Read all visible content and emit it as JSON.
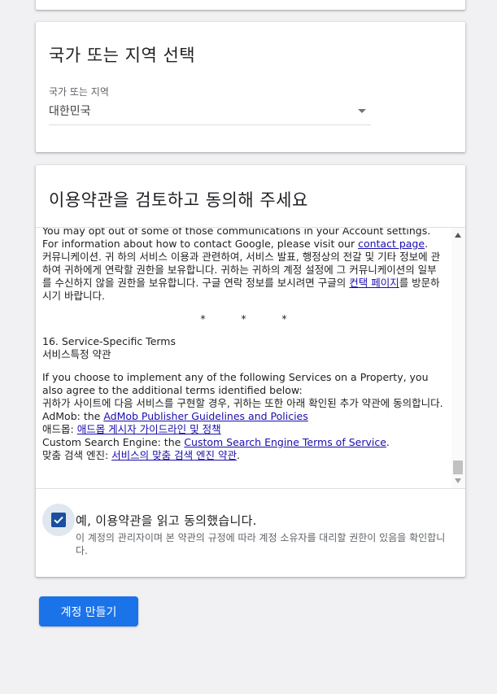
{
  "country_section": {
    "title": "국가 또는 지역 선택",
    "field_label": "국가 또는 지역",
    "selected_value": "대한민국"
  },
  "terms_section": {
    "title": "이용약관을 검토하고 동의해 주세요",
    "content": {
      "p1_en_a": "You may opt out of some of those communications in your Account settings. For information about how to contact Google, please visit our ",
      "p1_en_link": "contact page",
      "p1_en_b": ".",
      "p1_ko_a": "커뮤니케이션. 귀 하의 서비스 이용과 관련하여, 서비스 발표, 행정상의 전갈 및 기타 정보에 관하여 귀하에게 연락할 권한을 보유합니다. 귀하는 귀하의 계정 설정에 그 커뮤니케이션의 일부를 수신하지 않을 권한을 보유합니다. 구글 연락 정보를 보시려면 구글의 ",
      "p1_ko_link": "컨택 페이지",
      "p1_ko_b": "를 방문하시기 바랍니다.",
      "stars": [
        "*",
        "*",
        "*"
      ],
      "s16_en": "16. Service-Specific Terms",
      "s16_ko": "서비스특정 약관",
      "p2_en": "If you choose to implement any of the following Services on a Property, you also agree to the additional terms identified below:",
      "p2_ko": "귀하가 사이트에 다음 서비스를 구현할 경우, 귀하는 또한 아래 확인된 추가 약관에 동의합니다.",
      "admob_en_label": "AdMob: the ",
      "admob_en_link": "AdMob Publisher Guidelines and Policies",
      "admob_ko_label": "애드몹: ",
      "admob_ko_link": "애드몹 게시자 가이드라인 및 정책",
      "cse_en_label": "Custom Search Engine: the ",
      "cse_en_link": "Custom Search Engine Terms of Service",
      "cse_en_end": ".",
      "cse_ko_label": "맞춤 검색 엔진: ",
      "cse_ko_link": "서비스의 맞춤 검색 엔진 약관",
      "cse_ko_end": "."
    },
    "agree_checked": true,
    "agree_label": "예, 이용약관을 읽고 동의했습니다.",
    "agree_description": "이 계정의 관리자이며 본 약관의 규정에 따라 계정 소유자를 대리할 권한이 있음을 확인합니다."
  },
  "submit_button": "계정 만들기",
  "colors": {
    "primary": "#1a73e8",
    "checkbox": "#1a4fa0",
    "link": "#1a0dab"
  }
}
